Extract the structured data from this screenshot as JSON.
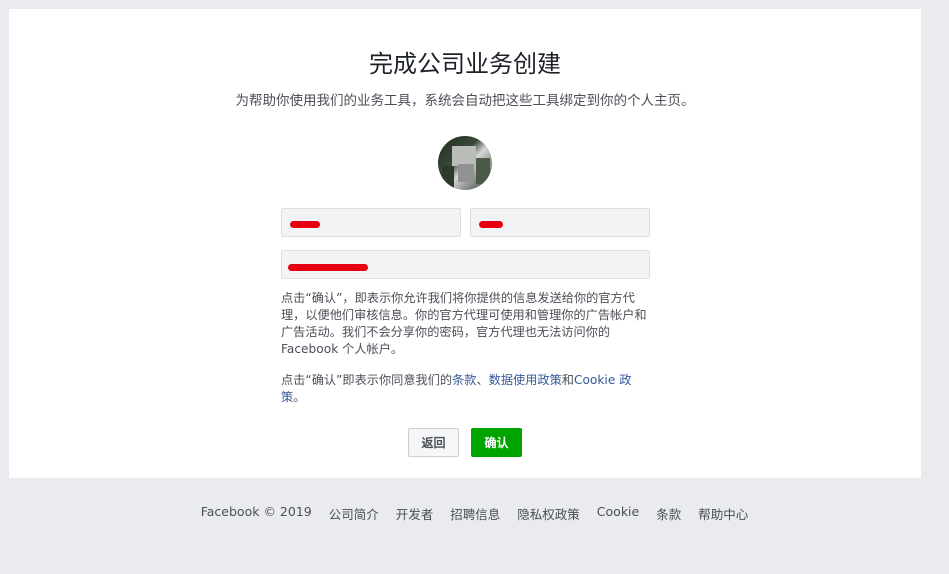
{
  "page": {
    "title": "完成公司业务创建",
    "subtitle": "为帮助你使用我们的业务工具，系统会自动把这些工具绑定到你的个人主页。"
  },
  "form": {
    "first_name": {
      "value": ""
    },
    "last_name": {
      "value": ""
    },
    "email": {
      "value": ""
    }
  },
  "disclaimer": "点击“确认”，即表示你允许我们将你提供的信息发送给你的官方代理，以便他们审核信息。你的官方代理可使用和管理你的广告帐户和广告活动。我们不会分享你的密码，官方代理也无法访问你的Facebook 个人帐户。",
  "terms": {
    "prefix": "点击“确认”即表示你同意我们的",
    "link_terms": "条款",
    "sep1": "、",
    "link_data_policy": "数据使用政策",
    "sep2": "和",
    "link_cookie": "Cookie 政策",
    "suffix": "。"
  },
  "buttons": {
    "back": "返回",
    "confirm": "确认"
  },
  "footer": {
    "copyright": "Facebook © 2019",
    "links": [
      "公司简介",
      "开发者",
      "招聘信息",
      "隐私权政策",
      "Cookie",
      "条款",
      "帮助中心"
    ]
  },
  "colors": {
    "background": "#e9ebee",
    "card": "#ffffff",
    "confirm_button": "#00a400",
    "link": "#365899",
    "redaction": "#e60012"
  }
}
